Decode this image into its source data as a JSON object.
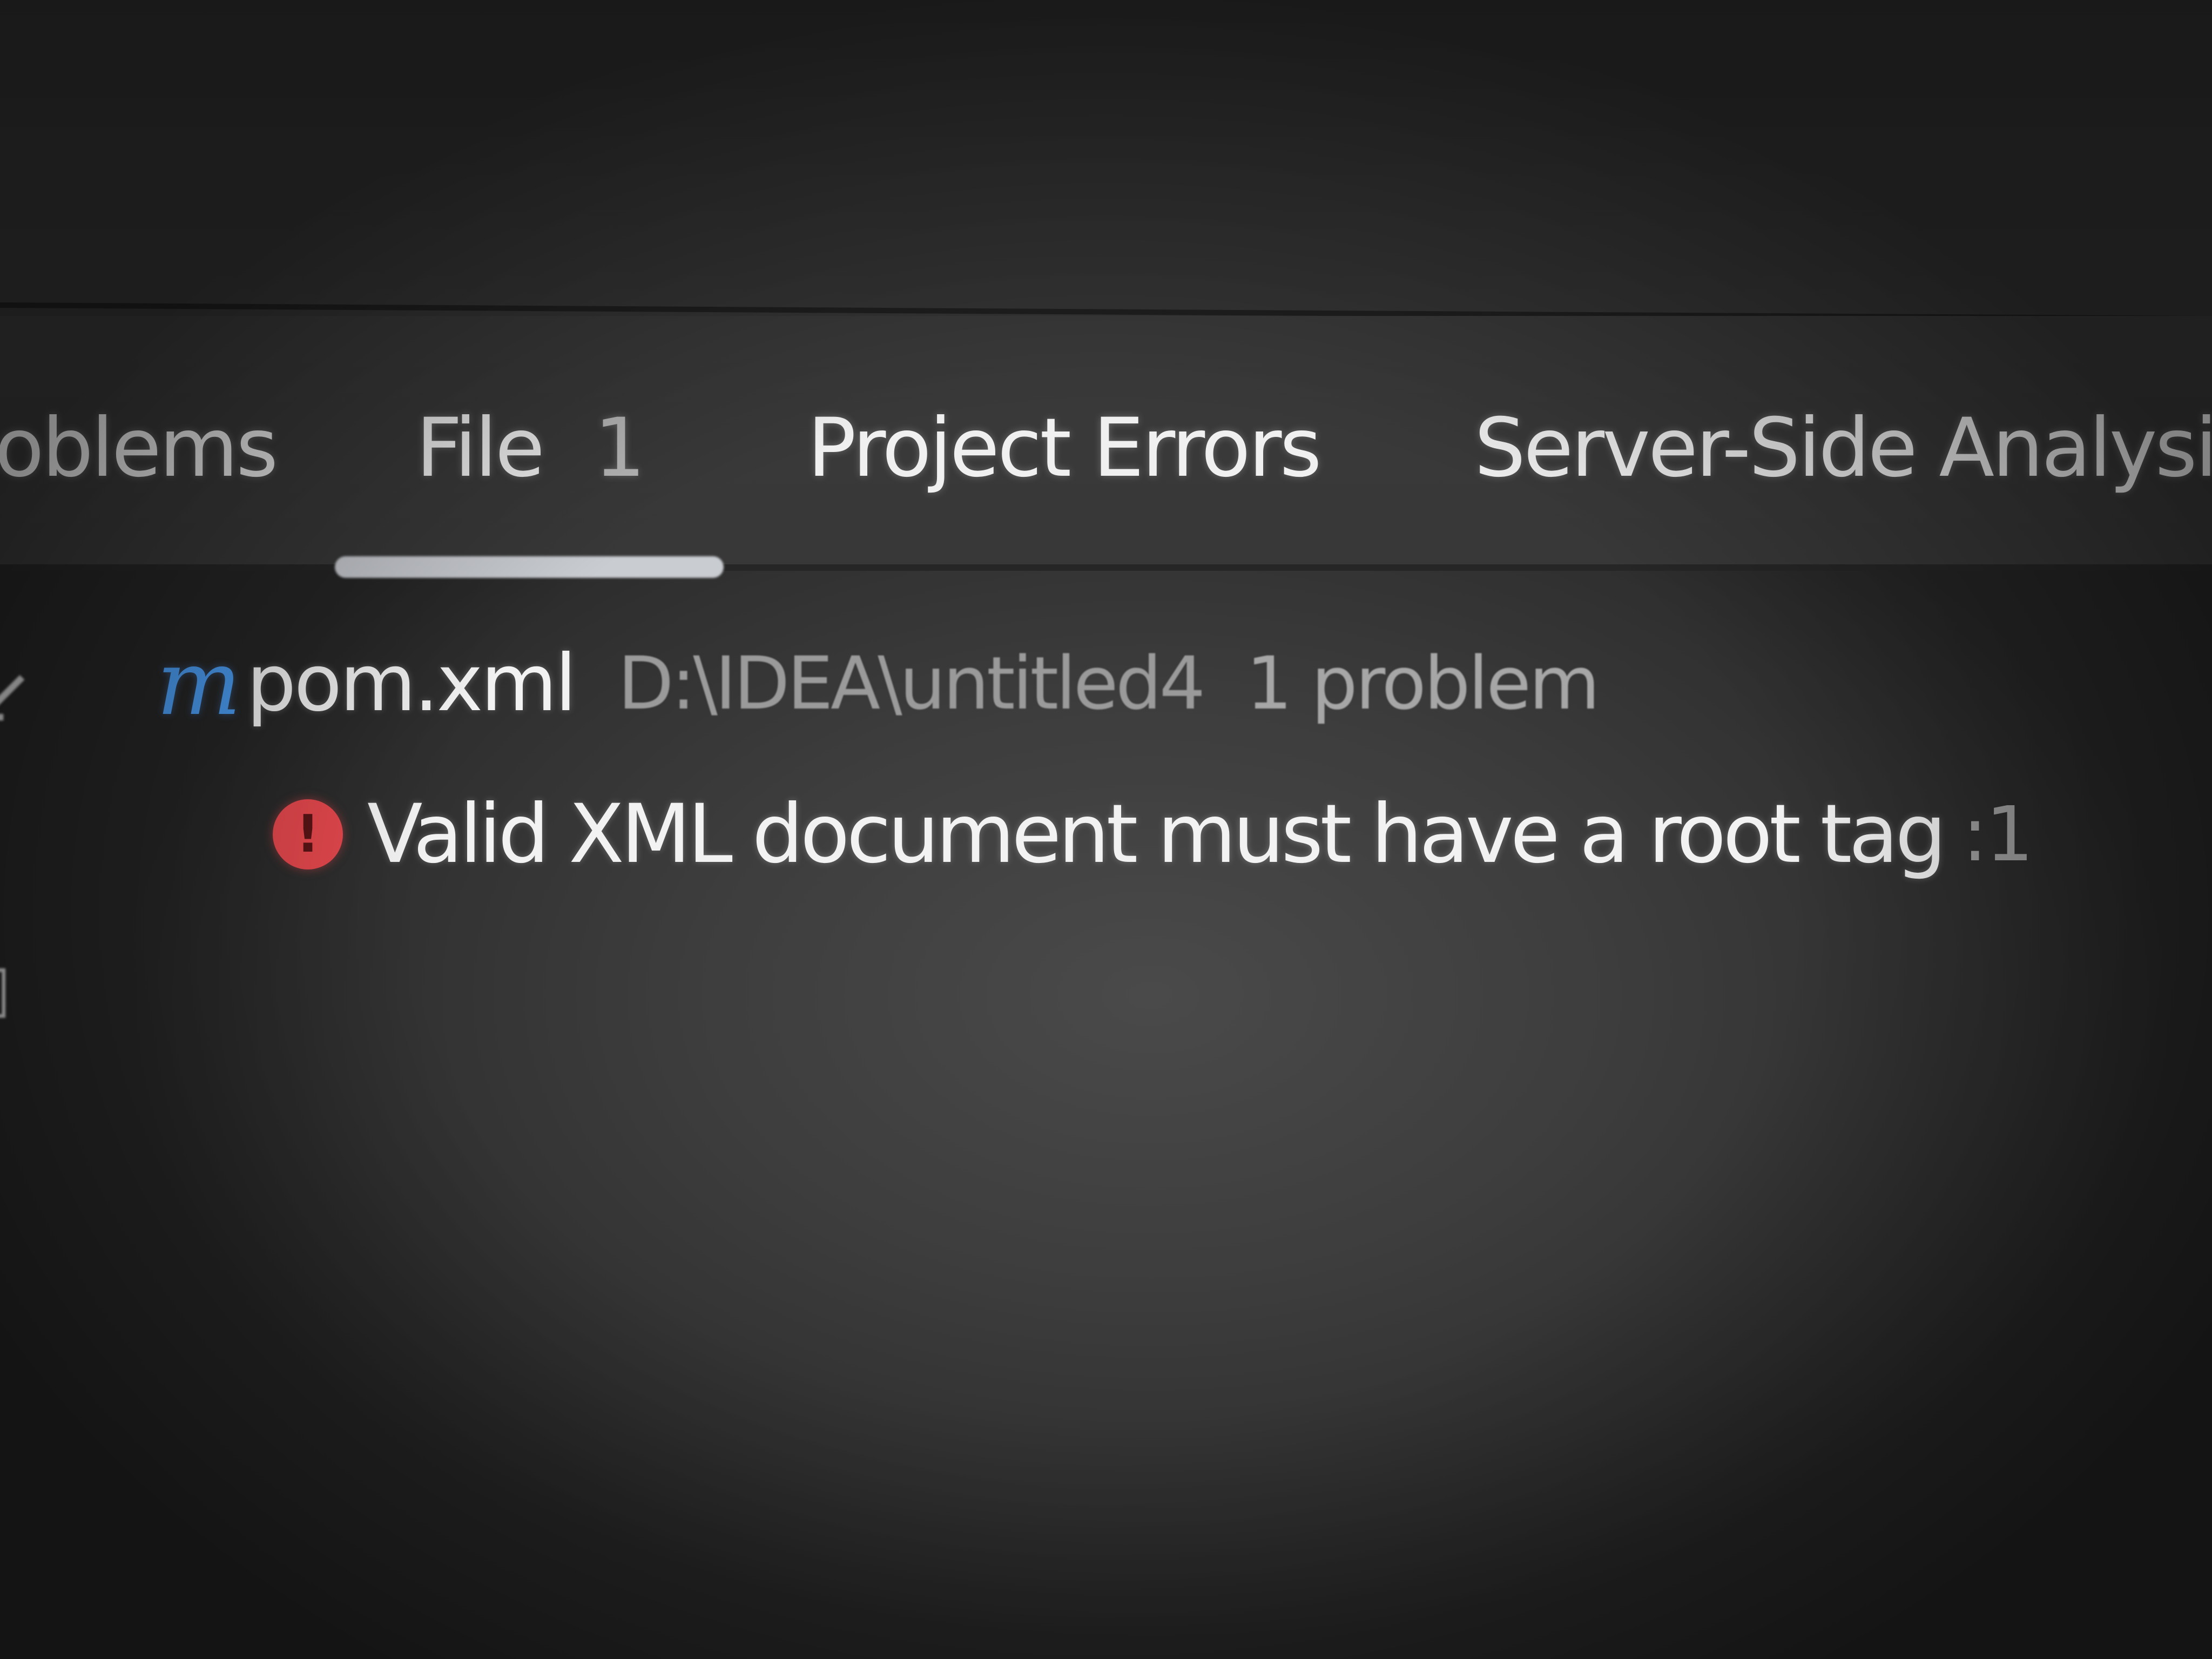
{
  "tabs": [
    {
      "label": "oblems",
      "count": ""
    },
    {
      "label": "File",
      "count": "1"
    },
    {
      "label": "Project Errors",
      "count": ""
    },
    {
      "label": "Server-Side Analysis",
      "count": ""
    }
  ],
  "file": {
    "icon": "maven-icon",
    "icon_glyph": "m",
    "name": "pom.xml",
    "path": "D:\\IDEA\\untitled4",
    "problems": "1 problem"
  },
  "error": {
    "icon": "error-icon",
    "icon_glyph": "!",
    "message": "Valid XML document must have a root tag",
    "line": ":1"
  },
  "colors": {
    "accent_blue": "#4a9bf0",
    "error_red": "#e5484d",
    "background": "#3c3c3c"
  }
}
